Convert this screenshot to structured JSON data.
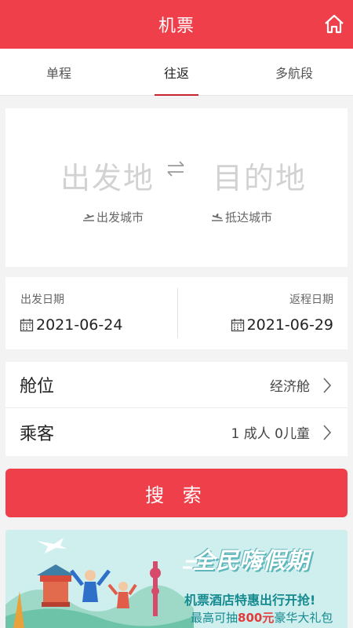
{
  "header": {
    "title": "机票",
    "home_icon": "home-icon",
    "color": "#ee3f4a"
  },
  "tabs": [
    {
      "label": "单程",
      "active": false
    },
    {
      "label": "往返",
      "active": true
    },
    {
      "label": "多航段",
      "active": false
    }
  ],
  "route": {
    "from_placeholder": "出发地",
    "to_placeholder": "目的地",
    "from_sub": "出发城市",
    "to_sub": "抵达城市",
    "swap_icon": "swap-arrows-icon"
  },
  "dates": {
    "depart_label": "出发日期",
    "depart_value": "2021-06-24",
    "return_label": "返程日期",
    "return_value": "2021-06-29",
    "icon": "calendar-icon"
  },
  "options": {
    "cabin_label": "舱位",
    "cabin_value": "经济舱",
    "passenger_label": "乘客",
    "passenger_value": "1 成人 0儿童"
  },
  "search": {
    "label": "搜 索"
  },
  "banner": {
    "title": "全民嗨假期",
    "subtitle": "机票酒店特惠出行开抢!",
    "prize_prefix": "最高可抽",
    "prize_amount": "800元",
    "prize_suffix": "豪华大礼包"
  }
}
